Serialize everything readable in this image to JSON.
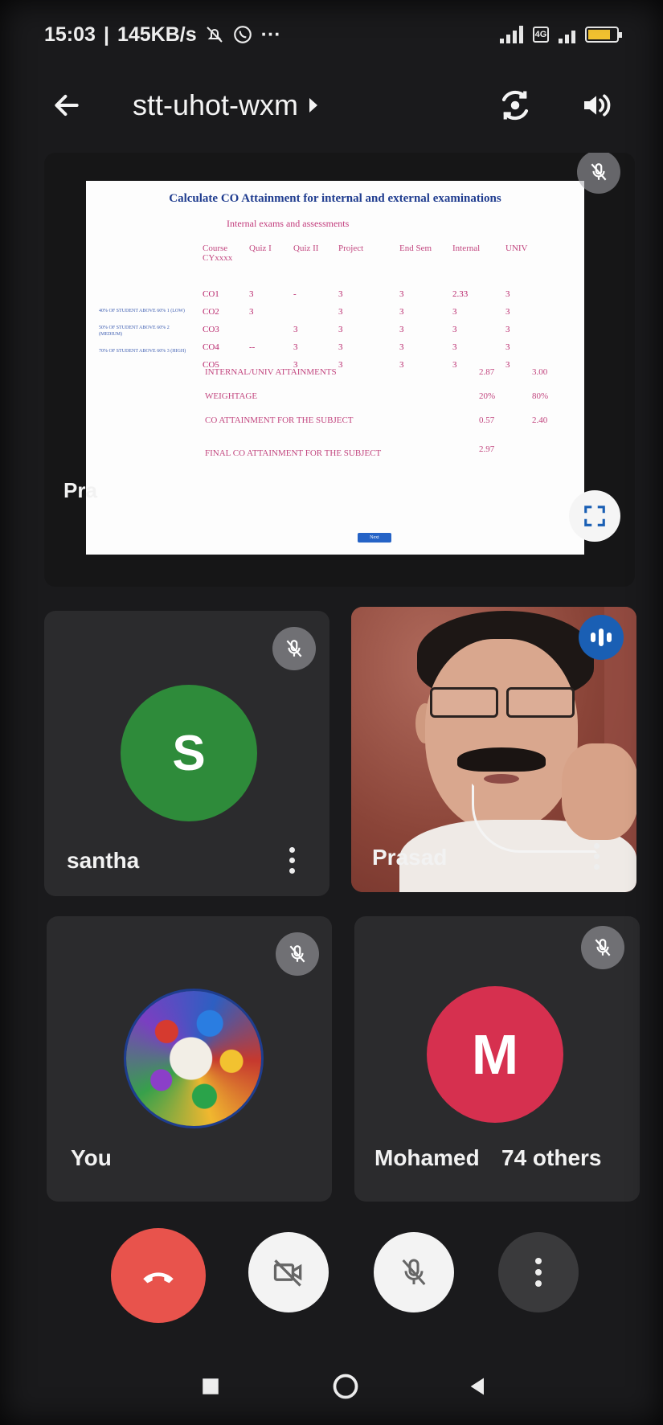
{
  "status_bar": {
    "time": "15:03",
    "speed": "145KB/s",
    "icons": [
      "mute-alarm-icon",
      "whatsapp-icon",
      "more-notifications-icon",
      "signal-icon",
      "sim-icon",
      "battery-icon"
    ],
    "more": "···"
  },
  "meeting": {
    "code": "stt-uhot-wxm",
    "icons": [
      "back-arrow-icon",
      "switch-camera-icon",
      "speaker-icon"
    ]
  },
  "presentation": {
    "presenter_label": "Pra",
    "slide": {
      "title": "Calculate CO Attainment for internal and external examinations",
      "subtitle": "Internal exams and assessments",
      "columns": [
        "Course CYxxxx",
        "Quiz I",
        "Quiz II",
        "Project",
        "End Sem",
        "Internal",
        "UNIV"
      ],
      "rows": [
        [
          "CO1",
          "3",
          "-",
          "3",
          "3",
          "2.33",
          "3"
        ],
        [
          "CO2",
          "3",
          "",
          "3",
          "3",
          "3",
          "3"
        ],
        [
          "CO3",
          "",
          "3",
          "3",
          "3",
          "3",
          "3"
        ],
        [
          "CO4",
          "--",
          "3",
          "3",
          "3",
          "3",
          "3"
        ],
        [
          "CO5",
          "",
          "3",
          "3",
          "3",
          "3",
          "3"
        ]
      ],
      "side_notes": [
        "40% OF STUDENT ABOVE 60% 1 (LOW)",
        "50% OF STUDENT ABOVE 60% 2 (MEDIUM)",
        "70% OF STUDENT ABOVE 60% 3 (HIGH)"
      ],
      "summary": [
        {
          "label": "INTERNAL/UNIV ATTAINMENTS",
          "internal": "2.87",
          "univ": "3.00"
        },
        {
          "label": "WEIGHTAGE",
          "internal": "20%",
          "univ": "80%"
        },
        {
          "label": "CO ATTAINMENT FOR THE SUBJECT",
          "internal": "0.57",
          "univ": "2.40"
        },
        {
          "label": "FINAL CO ATTAINMENT FOR THE SUBJECT",
          "internal": "2.97",
          "univ": ""
        }
      ],
      "button": "Next"
    }
  },
  "participants": {
    "santha": {
      "name": "santha",
      "initial": "S",
      "color": "#2e8b3a"
    },
    "prasad": {
      "name": "Prasad"
    },
    "you": {
      "name": "You"
    },
    "others": {
      "name": "Mohamed",
      "count": "74 others",
      "initial": "M",
      "color": "#d6304f"
    }
  },
  "controls": {
    "icons": [
      "end-call-icon",
      "camera-off-icon",
      "mic-off-icon",
      "more-vert-icon"
    ]
  },
  "nav": {
    "icons": [
      "recents-icon",
      "home-icon",
      "back-icon"
    ]
  }
}
